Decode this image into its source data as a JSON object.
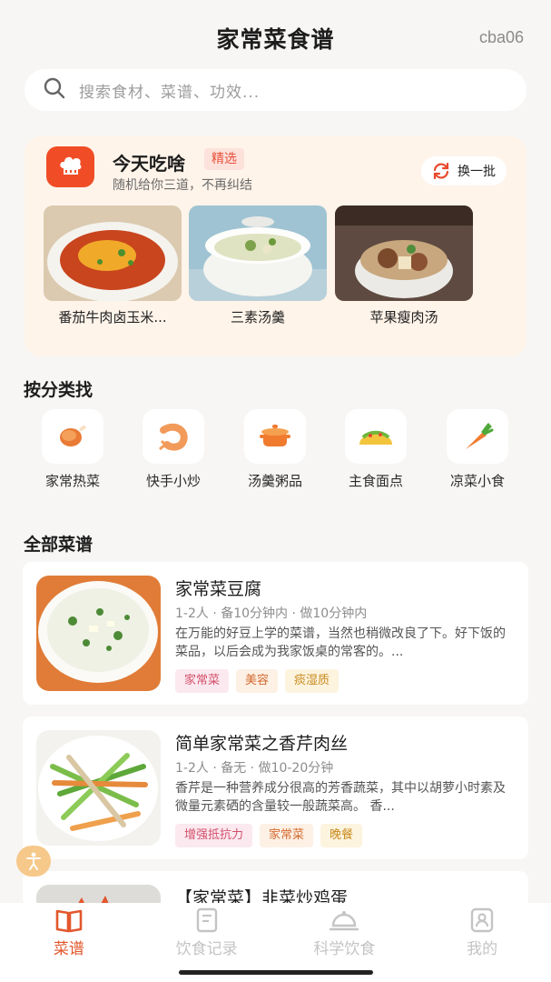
{
  "header": {
    "title": "家常菜食谱",
    "user_id": "cba06"
  },
  "search": {
    "placeholder": "搜索食材、菜谱、功效..."
  },
  "today": {
    "title": "今天吃啥",
    "badge": "精选",
    "subtitle": "随机给你三道，不再纠结",
    "refresh_label": "换一批",
    "dishes": [
      {
        "name": "番茄牛肉卤玉米..."
      },
      {
        "name": "三素汤羹"
      },
      {
        "name": "苹果瘦肉汤"
      }
    ]
  },
  "categories": {
    "title": "按分类找",
    "items": [
      {
        "label": "家常热菜",
        "icon": "drumstick-icon"
      },
      {
        "label": "快手小炒",
        "icon": "shrimp-icon"
      },
      {
        "label": "汤羹粥品",
        "icon": "pot-icon"
      },
      {
        "label": "主食面点",
        "icon": "taco-icon"
      },
      {
        "label": "凉菜小食",
        "icon": "carrot-icon"
      }
    ]
  },
  "recipes": {
    "title": "全部菜谱",
    "items": [
      {
        "title": "家常菜豆腐",
        "meta": "1-2人 · 备10分钟内 · 做10分钟内",
        "desc": "在万能的好豆上学的菜谱，当然也稍微改良了下。好下饭的菜品，以后会成为我家饭桌的常客的。...",
        "tags": [
          "家常菜",
          "美容",
          "痰湿质"
        ]
      },
      {
        "title": "简单家常菜之香芹肉丝",
        "meta": "1-2人 · 备无 · 做10-20分钟",
        "desc": "香芹是一种营养成分很高的芳香蔬菜，其中以胡萝小时素及微量元素硒的含量较一般蔬菜高。 香...",
        "tags": [
          "增强抵抗力",
          "家常菜",
          "晚餐"
        ]
      },
      {
        "title": "【家常菜】韭菜炒鸡蛋"
      }
    ]
  },
  "nav": {
    "items": [
      {
        "label": "菜谱",
        "active": true
      },
      {
        "label": "饮食记录"
      },
      {
        "label": "科学饮食"
      },
      {
        "label": "我的"
      }
    ]
  },
  "colors": {
    "accent": "#e2572c",
    "card_bg": "#fff4ea"
  }
}
